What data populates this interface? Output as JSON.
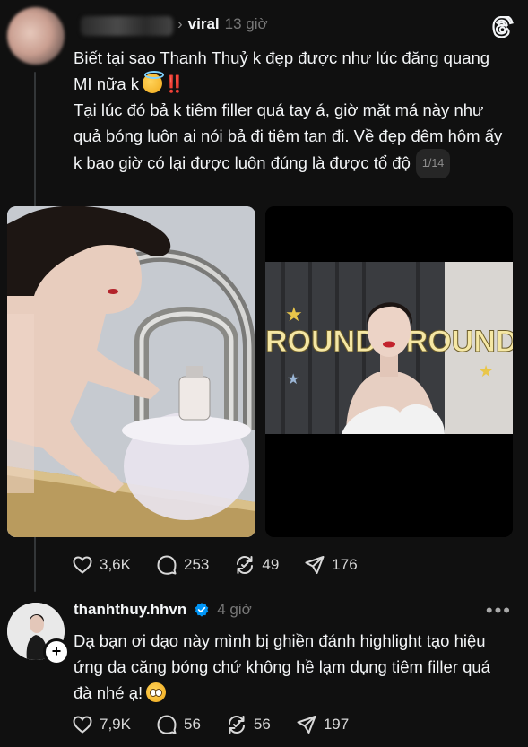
{
  "post": {
    "author_label": "viral",
    "time": "13 giờ",
    "text_line1": "Biết tại sao Thanh Thuỷ k đẹp được như lúc đăng quang MI nữa k",
    "bang": "‼️",
    "text_line2": "Tại lúc đó bả k tiêm filler quá tay á, giờ mặt má này như quả bóng luôn ai nói bả đi tiêm tan đi. Về đẹp đêm hôm ấy k bao giờ có lại được luôn đúng là được tổ độ",
    "page_indicator": "1/14",
    "image2_banner": "ROUNDS ROUND",
    "likes": "3,6K",
    "comments": "253",
    "reposts": "49",
    "shares": "176"
  },
  "reply": {
    "username": "thanhthuy.hhvn",
    "time": "4 giờ",
    "text": "Dạ bạn ơi dạo này mình bị ghiền đánh highlight tạo hiệu ứng da căng bóng chứ không hề lạm dụng tiêm filler quá đà nhé ạ!",
    "likes": "7,9K",
    "comments": "56",
    "reposts": "56",
    "shares": "197",
    "follow_symbol": "+",
    "more_symbol": "•••"
  },
  "colors": {
    "background": "#101010",
    "text": "#f3f5f7",
    "muted": "#777777",
    "verified": "#0095f6",
    "alert": "#ff2d2d"
  }
}
